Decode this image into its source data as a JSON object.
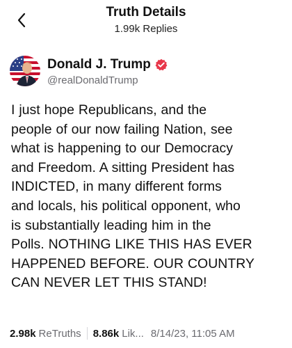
{
  "header": {
    "title": "Truth Details",
    "subtitle": "1.99k Replies"
  },
  "author": {
    "name": "Donald J. Trump",
    "handle": "@realDonaldTrump",
    "verified_color": "#e8374a"
  },
  "post": {
    "text": "I just hope Republicans, and the\npeople of our now failing Nation, see\nwhat is happening to our Democracy\nand Freedom. A sitting President has\nINDICTED, in many different forms\nand locals, his political opponent, who\nis substantially leading him in the\nPolls. NOTHING LIKE THIS HAS EVER\nHAPPENED BEFORE. OUR COUNTRY\nCAN NEVER LET THIS STAND!"
  },
  "stats": {
    "retruths_count": "2.98k",
    "retruths_label": "ReTruths",
    "likes_count": "8.86k",
    "likes_label": "Lik...",
    "date": "8/14/23, 11:05 AM"
  },
  "icons": {
    "back": "chevron-left-icon",
    "verified": "verified-badge-icon"
  }
}
